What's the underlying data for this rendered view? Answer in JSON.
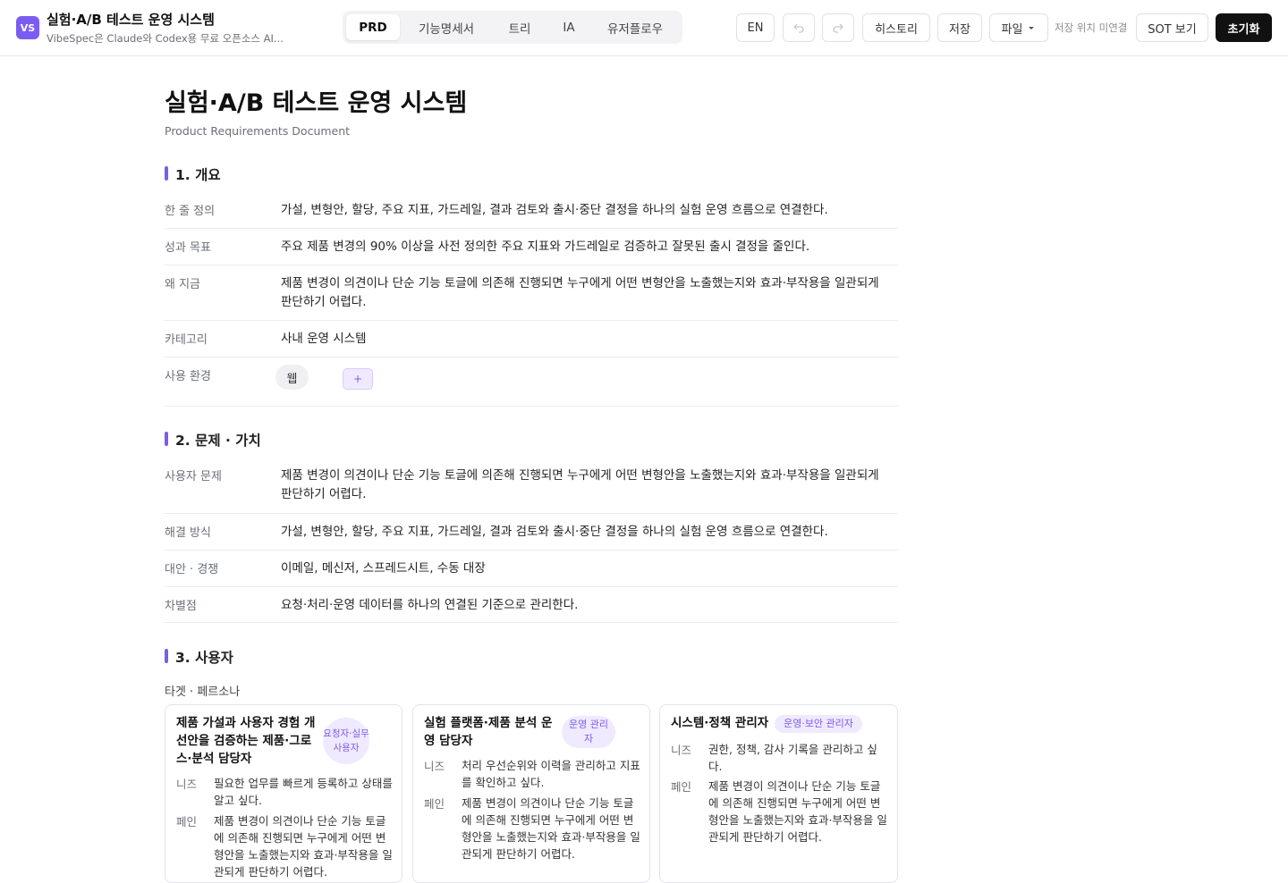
{
  "app": {
    "logo": "VS",
    "title": "실험·A/B 테스트 운영 시스템",
    "subtitle": "VibeSpec은 Claude와 Codex용 무료 오픈소스 AI..."
  },
  "tabs": [
    {
      "label": "PRD",
      "active": true
    },
    {
      "label": "기능명세서",
      "active": false
    },
    {
      "label": "트리",
      "active": false
    },
    {
      "label": "IA",
      "active": false
    },
    {
      "label": "유저플로우",
      "active": false
    }
  ],
  "header": {
    "lang": "EN",
    "undo_icon": "undo-icon",
    "redo_icon": "redo-icon",
    "history": "히스토리",
    "save": "저장",
    "file": "파일",
    "file_chevron": "chevron-down-icon",
    "save_location": "저장 위치 미연결",
    "sot": "SOT 보기",
    "reset": "초기화"
  },
  "doc": {
    "title": "실험·A/B 테스트 운영 시스템",
    "subtitle": "Product Requirements Document",
    "s1": {
      "heading": "1. 개요",
      "rows": [
        {
          "k": "한 줄 정의",
          "v": "가설, 변형안, 할당, 주요 지표, 가드레일, 결과 검토와 출시·중단 결정을 하나의 실험 운영 흐름으로 연결한다."
        },
        {
          "k": "성과 목표",
          "v": "주요 제품 변경의 90% 이상을 사전 정의한 주요 지표와 가드레일로 검증하고 잘못된 출시 결정을 줄인다."
        },
        {
          "k": "왜 지금",
          "v": "제품 변경이 의견이나 단순 기능 토글에 의존해 진행되면 누구에게 어떤 변형안을 노출했는지와 효과·부작용을 일관되게 판단하기 어렵다."
        },
        {
          "k": "카테고리",
          "v": "사내 운영 시스템"
        },
        {
          "k": "사용 환경",
          "v": ""
        }
      ],
      "env_chip": "웹",
      "add_chip": "+"
    },
    "s2": {
      "heading": "2. 문제 · 가치",
      "rows": [
        {
          "k": "사용자 문제",
          "v": "제품 변경이 의견이나 단순 기능 토글에 의존해 진행되면 누구에게 어떤 변형안을 노출했는지와 효과·부작용을 일관되게 판단하기 어렵다."
        },
        {
          "k": "해결 방식",
          "v": "가설, 변형안, 할당, 주요 지표, 가드레일, 결과 검토와 출시·중단 결정을 하나의 실험 운영 흐름으로 연결한다."
        },
        {
          "k": "대안 · 경쟁",
          "v": "이메일, 메신저, 스프레드시트, 수동 대장"
        },
        {
          "k": "차별점",
          "v": "요청·처리·운영 데이터를 하나의 연결된 기준으로 관리한다."
        }
      ]
    },
    "s3": {
      "heading": "3. 사용자",
      "sub_label": "타겟 · 페르소나",
      "personas": [
        {
          "title": "제품 가설과 사용자 경험 개선안을 검증하는 제품·그로스·분석 담당자",
          "badge": "요청자·실무 사용자",
          "needs_label": "니즈",
          "needs": "필요한 업무를 빠르게 등록하고 상태를 알고 싶다.",
          "pain_label": "페인",
          "pain": "제품 변경이 의견이나 단순 기능 토글에 의존해 진행되면 누구에게 어떤 변형안을 노출했는지와 효과·부작용을 일관되게 판단하기 어렵다."
        },
        {
          "title": "실험 플랫폼·제품 분석 운영 담당자",
          "badge": "운영 관리자",
          "needs_label": "니즈",
          "needs": "처리 우선순위와 이력을 관리하고 지표를 확인하고 싶다.",
          "pain_label": "페인",
          "pain": "제품 변경이 의견이나 단순 기능 토글에 의존해 진행되면 누구에게 어떤 변형안을 노출했는지와 효과·부작용을 일관되게 판단하기 어렵다."
        },
        {
          "title": "시스템·정책 관리자",
          "badge": "운영·보안 관리자",
          "needs_label": "니즈",
          "needs": "권한, 정책, 감사 기록을 관리하고 싶다.",
          "pain_label": "페인",
          "pain": "제품 변경이 의견이나 단순 기능 토글에 의존해 진행되면 누구에게 어떤 변형안을 노출했는지와 효과·부작용을 일관되게 판단하기 어렵다."
        }
      ]
    }
  },
  "colors": {
    "accent": "#7c5cf0",
    "badge_bg": "#efeaff",
    "dark_button": "#111111"
  }
}
